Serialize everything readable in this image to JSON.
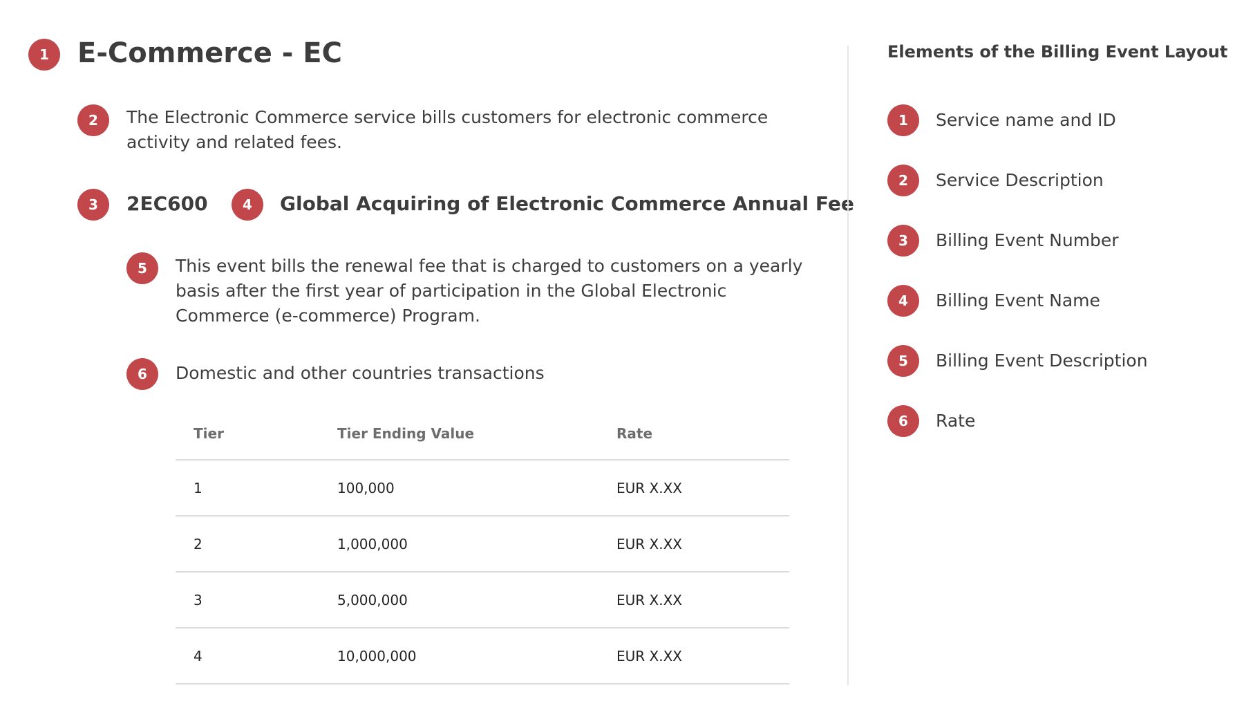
{
  "accent_color": "#c1474a",
  "main": {
    "title": {
      "badge": "1",
      "text": "E-Commerce - EC"
    },
    "service_description": {
      "badge": "2",
      "text": "The Electronic Commerce service bills customers for electronic commerce activity and related fees."
    },
    "event_number": {
      "badge": "3",
      "text": "2EC600"
    },
    "event_name": {
      "badge": "4",
      "text": "Global Acquiring of Electronic Commerce Annual Fee"
    },
    "event_description": {
      "badge": "5",
      "text": "This event bills the renewal fee that is charged to customers on a yearly basis after the first year of participation in the Global Electronic Commerce (e-commerce) Program."
    },
    "rate": {
      "badge": "6",
      "text": "Domestic and other countries transactions"
    },
    "table": {
      "headers": [
        "Tier",
        "Tier Ending Value",
        "Rate"
      ],
      "rows": [
        [
          "1",
          "100,000",
          "EUR X.XX"
        ],
        [
          "2",
          "1,000,000",
          "EUR X.XX"
        ],
        [
          "3",
          "5,000,000",
          "EUR X.XX"
        ],
        [
          "4",
          "10,000,000",
          "EUR X.XX"
        ]
      ]
    }
  },
  "sidebar": {
    "title": "Elements of the Billing Event Layout",
    "items": [
      {
        "badge": "1",
        "label": "Service name and ID"
      },
      {
        "badge": "2",
        "label": "Service Description"
      },
      {
        "badge": "3",
        "label": "Billing Event Number"
      },
      {
        "badge": "4",
        "label": "Billing Event Name"
      },
      {
        "badge": "5",
        "label": "Billing Event Description"
      },
      {
        "badge": "6",
        "label": "Rate"
      }
    ]
  }
}
